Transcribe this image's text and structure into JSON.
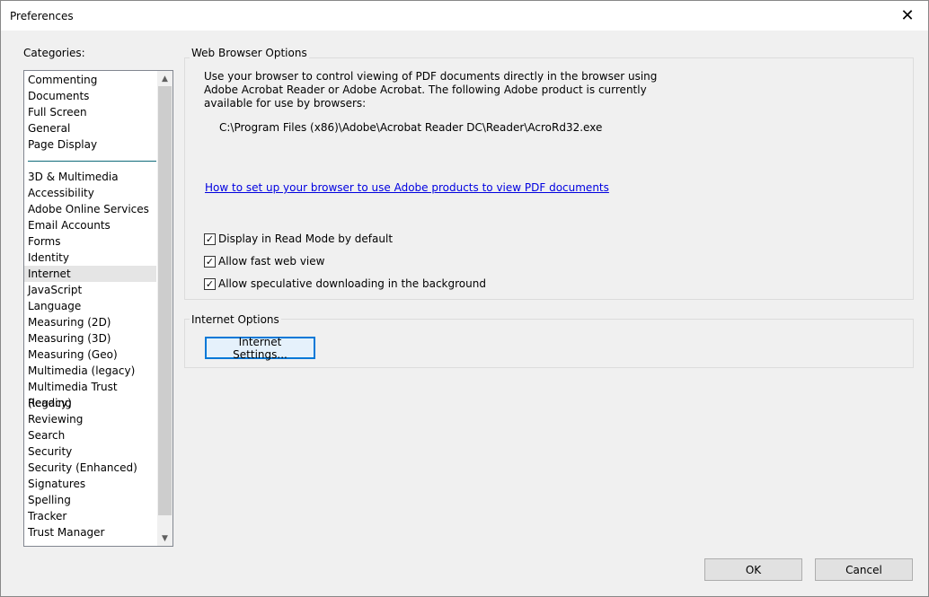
{
  "window": {
    "title": "Preferences",
    "close_glyph": "✕"
  },
  "categories": {
    "label": "Categories:",
    "group1": [
      "Commenting",
      "Documents",
      "Full Screen",
      "General",
      "Page Display"
    ],
    "group2": [
      "3D & Multimedia",
      "Accessibility",
      "Adobe Online Services",
      "Email Accounts",
      "Forms",
      "Identity",
      "Internet",
      "JavaScript",
      "Language",
      "Measuring (2D)",
      "Measuring (3D)",
      "Measuring (Geo)",
      "Multimedia (legacy)",
      "Multimedia Trust (legacy)",
      "Reading",
      "Reviewing",
      "Search",
      "Security",
      "Security (Enhanced)",
      "Signatures",
      "Spelling",
      "Tracker",
      "Trust Manager"
    ],
    "selected": "Internet"
  },
  "web_browser_options": {
    "title": "Web Browser Options",
    "description": "Use your browser to control viewing of PDF documents directly in the browser using Adobe Acrobat Reader or Adobe Acrobat. The following Adobe product is currently available for use by browsers:",
    "product_path": "C:\\Program Files (x86)\\Adobe\\Acrobat Reader DC\\Reader\\AcroRd32.exe",
    "help_link": "How to set up your browser to use Adobe products to view PDF documents",
    "checkboxes": [
      {
        "label": "Display in Read Mode by default",
        "checked": true
      },
      {
        "label": "Allow fast web view",
        "checked": true
      },
      {
        "label": "Allow speculative downloading in the background",
        "checked": true
      }
    ]
  },
  "internet_options": {
    "title": "Internet Options",
    "settings_button": "Internet Settings..."
  },
  "footer": {
    "ok": "OK",
    "cancel": "Cancel"
  },
  "icons": {
    "scroll_up": "chevron-up-icon",
    "scroll_down": "chevron-down-icon",
    "check": "✓"
  }
}
